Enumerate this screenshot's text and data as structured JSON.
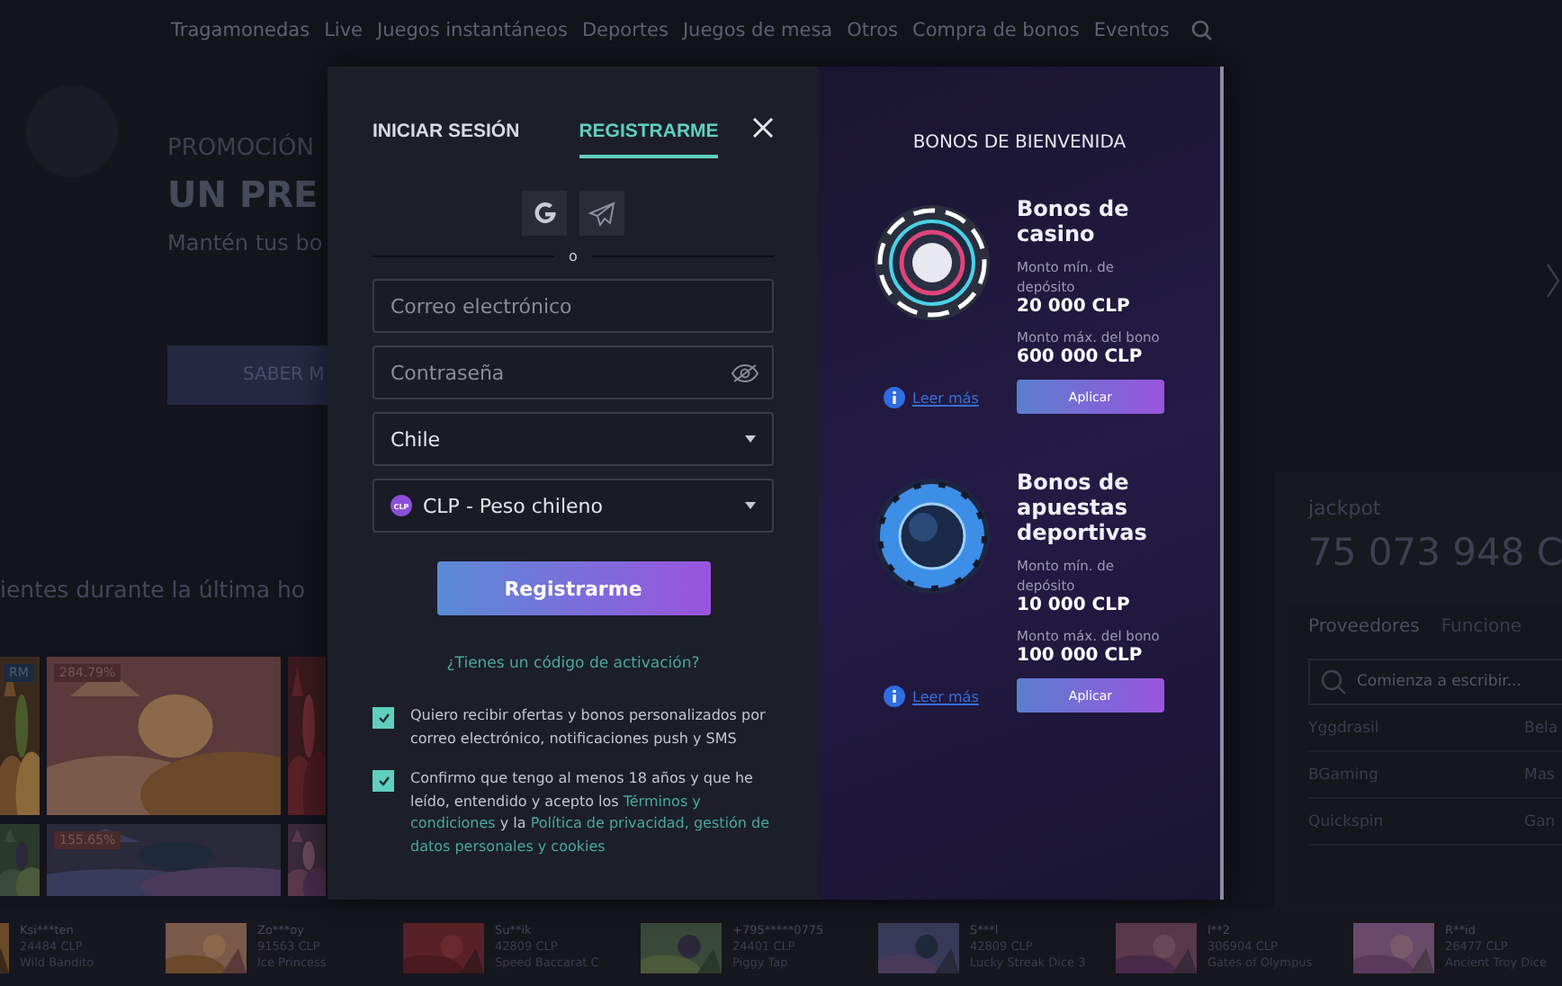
{
  "nav": {
    "items": [
      "Tragamonedas",
      "Live",
      "Juegos instantáneos",
      "Deportes",
      "Juegos de mesa",
      "Otros",
      "Compra de bonos",
      "Eventos"
    ]
  },
  "hero": {
    "eyebrow": "PROMOCIÓN",
    "title": "UN PRE",
    "subtitle": "Mantén tus bo",
    "button": "SABER M"
  },
  "games_section": {
    "heading": "ientes durante la última ho",
    "tiles": [
      {
        "kind": "picture",
        "badge": "RM"
      },
      {
        "kind": "picture",
        "badge": "284.79%"
      },
      {
        "kind": "picture"
      },
      {
        "kind": "picture"
      },
      {
        "kind": "picture",
        "badge": "155.65%"
      },
      {
        "kind": "picture"
      }
    ]
  },
  "jackpot": {
    "label": "jackpot",
    "amount": "75 073 948 C"
  },
  "providers": {
    "tabs": [
      {
        "label": "Proveedores",
        "selected": true
      },
      {
        "label": "Funcione",
        "selected": false
      }
    ],
    "search": {
      "placeholder": "Comienza a escribir..."
    },
    "rows": [
      [
        "Yggdrasil",
        "Bela"
      ],
      [
        "BGaming",
        "Mas"
      ],
      [
        "Quickspin",
        "Gan"
      ]
    ]
  },
  "winners": [
    {
      "name": "Ksi***ten",
      "amount": "24484 CLP",
      "game": "Wild Bandito"
    },
    {
      "name": "Zo***oy",
      "amount": "91563 CLP",
      "game": "Ice Princess"
    },
    {
      "name": "Su**ik",
      "amount": "42809 CLP",
      "game": "Speed Baccarat C"
    },
    {
      "name": "+795*****0775",
      "amount": "24401 CLP",
      "game": "Piggy Tap"
    },
    {
      "name": "S***l",
      "amount": "42809 CLP",
      "game": "Lucky Streak Dice 3"
    },
    {
      "name": "I**2",
      "amount": "306904 CLP",
      "game": "Gates of Olympus"
    },
    {
      "name": "R**id",
      "amount": "26477 CLP",
      "game": "Ancient Troy Dice"
    }
  ],
  "auth": {
    "tabs": [
      {
        "label": "INICIAR SESIÓN",
        "selected": false
      },
      {
        "label": "REGISTRARME",
        "selected": true
      }
    ],
    "fields": [
      {
        "kind": "text",
        "placeholder": "Correo electrónico"
      },
      {
        "kind": "password",
        "placeholder": "Contraseña"
      },
      {
        "kind": "select",
        "value": "Chile"
      },
      {
        "kind": "currency",
        "badge": "CLP",
        "value": "CLP - Peso chileno"
      }
    ],
    "divider": "o",
    "submit": "Registrarme",
    "activation_link": "¿Tienes un código de activación?",
    "consents": [
      {
        "checked": true,
        "parts": [
          {
            "kind": "text",
            "text": "Quiero recibir ofertas y bonos personalizados por correo electrónico, notificaciones push y SMS"
          }
        ]
      },
      {
        "checked": true,
        "parts": [
          {
            "kind": "text",
            "text": "Confirmo que tengo al menos 18 años y que he leído, entendido y acepto los"
          },
          {
            "kind": "link",
            "text": "Términos y"
          },
          {
            "kind": "link",
            "text": "condiciones"
          },
          {
            "kind": "text",
            "text": "y la"
          },
          {
            "kind": "link",
            "text": "Política de privacidad, gestión de"
          },
          {
            "kind": "link",
            "text": "datos personales y cookies"
          }
        ]
      }
    ]
  },
  "bonuses": {
    "title": "BONOS DE BIENVENIDA",
    "items": [
      {
        "kind": "casino",
        "title": "Bonos de casino",
        "min_label": "Monto mín. de depósito",
        "min_value": "20 000 CLP",
        "max_label": "Monto máx. del bono",
        "max_value": "600 000 CLP",
        "info_link": "Leer más",
        "button": "Aplicar"
      },
      {
        "kind": "sport",
        "title": "Bonos de apuestas deportivas",
        "min_label": "Monto mín. de depósito",
        "min_value": "10 000 CLP",
        "max_label": "Monto máx. del bono",
        "max_value": "100 000 CLP",
        "info_link": "Leer más",
        "button": "Aplicar"
      }
    ]
  }
}
